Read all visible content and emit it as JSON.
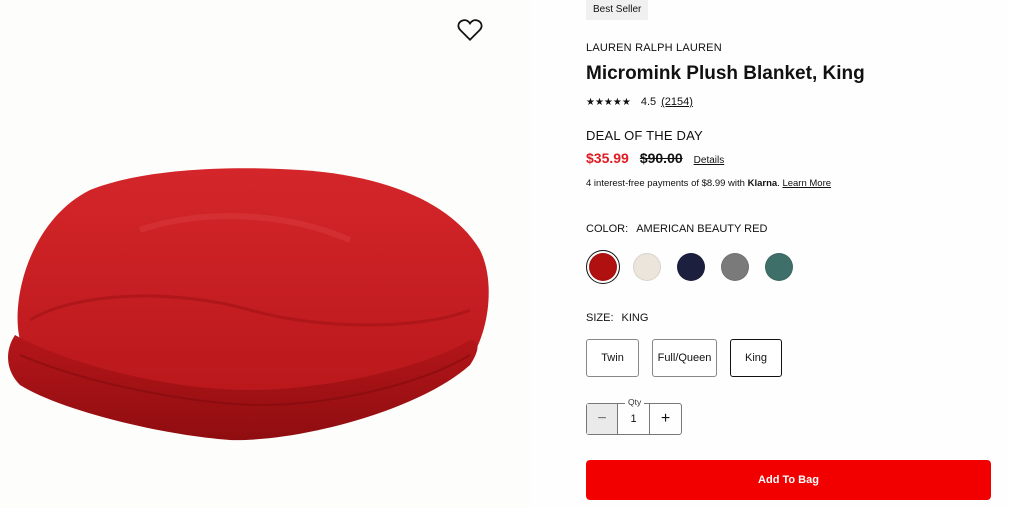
{
  "product": {
    "badge": "Best Seller",
    "brand": "LAUREN RALPH LAUREN",
    "title": "Micromink Plush Blanket, King",
    "rating": {
      "stars": "★★★★★",
      "value": "4.5",
      "count": "(2154)"
    },
    "deal_label": "DEAL OF THE DAY",
    "sale_price": "$35.99",
    "original_price": "$90.00",
    "details_link": "Details",
    "klarna": {
      "prefix": "4 interest-free payments of $8.99 with ",
      "brand": "Klarna",
      "suffix": ". ",
      "link": "Learn More"
    }
  },
  "color": {
    "label": "COLOR:",
    "selected": "AMERICAN BEAUTY RED",
    "swatches": [
      {
        "name": "red",
        "hex": "#b0100f"
      },
      {
        "name": "ivory",
        "hex": "#ebe5dc"
      },
      {
        "name": "navy",
        "hex": "#1c1f3d"
      },
      {
        "name": "grey",
        "hex": "#7a7a7a"
      },
      {
        "name": "teal",
        "hex": "#3f6f69"
      }
    ]
  },
  "size": {
    "label": "SIZE:",
    "selected": "KING",
    "options": [
      "Twin",
      "Full/Queen",
      "King"
    ]
  },
  "quantity": {
    "label": "Qty",
    "value": "1",
    "minus": "−",
    "plus": "+"
  },
  "actions": {
    "add_to_bag": "Add To Bag"
  },
  "icons": {
    "favorite": "heart-icon"
  },
  "colors": {
    "sale": "#e11b22",
    "cta": "#f20000"
  }
}
